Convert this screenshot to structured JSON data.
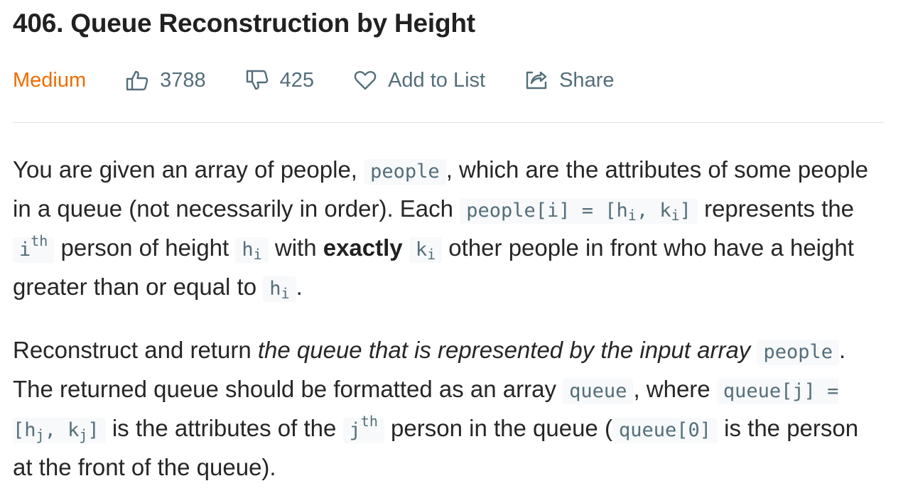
{
  "problem": {
    "title": "406. Queue Reconstruction by Height",
    "difficulty": "Medium",
    "likes": "3788",
    "dislikes": "425",
    "add_to_list_label": "Add to List",
    "share_label": "Share"
  },
  "colors": {
    "difficulty_medium": "#ef6c00",
    "meta_text": "#546e7a",
    "code_bg": "#f7f9fa",
    "code_text": "#546e7a"
  },
  "icons": {
    "likes": "thumbs-up-icon",
    "dislikes": "thumbs-down-icon",
    "add_to_list": "heart-icon",
    "share": "share-icon"
  },
  "description": {
    "p1": {
      "t1": "You are given an array of people, ",
      "c1": "people",
      "t2": ", which are the attributes of some people in a queue (not necessarily in order). Each ",
      "c2_pre": "people[i] = [h",
      "c2_sub1": "i",
      "c2_mid": ", k",
      "c2_sub2": "i",
      "c2_post": "]",
      "t3": " represents the ",
      "c3": "i",
      "c3_sup": "th",
      "t4": " person of height ",
      "c4": "h",
      "c4_sub": "i",
      "t5": " with ",
      "b1": "exactly",
      "t6": " ",
      "c5": "k",
      "c5_sub": "i",
      "t7": " other people in front who have a height greater than or equal to ",
      "c6": "h",
      "c6_sub": "i",
      "t8": "."
    },
    "p2": {
      "t1": "Reconstruct and return ",
      "em1": "the queue that is represented by the input array",
      "t2": " ",
      "c1": "people",
      "t3": ". The returned queue should be formatted as an array ",
      "c2": "queue",
      "t4": ", where ",
      "c3_pre": "queue[j] = [h",
      "c3_sub1": "j",
      "c3_mid": ", k",
      "c3_sub2": "j",
      "c3_post": "]",
      "t5": " is the attributes of the ",
      "c4": "j",
      "c4_sup": "th",
      "t6": " person in the queue (",
      "c5": "queue[0]",
      "t7": " is the person at the front of the queue)."
    }
  }
}
